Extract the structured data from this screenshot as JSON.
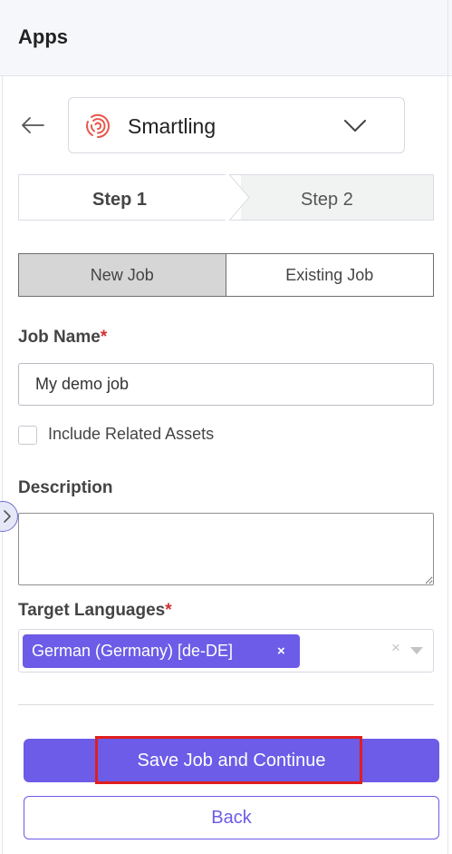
{
  "header": {
    "title": "Apps"
  },
  "app_selector": {
    "name": "Smartling",
    "logo_icon": "smartling-logo-icon",
    "accent": "#e8564a"
  },
  "steps": [
    {
      "label": "Step 1",
      "active": true
    },
    {
      "label": "Step 2",
      "active": false
    }
  ],
  "job_toggle": {
    "new_label": "New Job",
    "existing_label": "Existing Job",
    "selected": "New Job"
  },
  "job_name": {
    "label": "Job Name",
    "required_mark": "*",
    "value": "My demo job"
  },
  "include_related": {
    "label": "Include Related Assets",
    "checked": false
  },
  "description": {
    "label": "Description",
    "value": ""
  },
  "target_languages": {
    "label": "Target Languages",
    "required_mark": "*",
    "selected": [
      "German (Germany) [de-DE]"
    ],
    "remove_glyph": "×",
    "clear_glyph": "×"
  },
  "actions": {
    "save_label": "Save Job and Continue",
    "back_label": "Back"
  },
  "colors": {
    "primary": "#6c5ce7",
    "highlight": "#e01e1e",
    "required": "#d32f2f"
  }
}
